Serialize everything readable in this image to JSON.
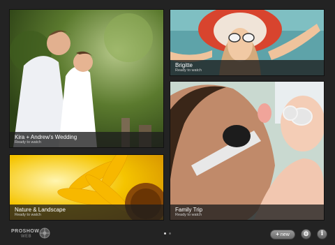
{
  "tiles": [
    {
      "title": "Kira + Andrew's Wedding",
      "status": "Ready to watch"
    },
    {
      "title": "Brigitte",
      "status": "Ready to watch"
    },
    {
      "title": "Nature & Landscape",
      "status": "Ready to watch"
    },
    {
      "title": "Family Trip",
      "status": "Ready to watch"
    }
  ],
  "logo": {
    "word1": "PROSHOW",
    "word2": "WEB"
  },
  "pager": {
    "pages": 2,
    "current": 1
  },
  "toolbar": {
    "new_label": "new",
    "new_icon": "plus-icon",
    "settings_icon": "gear-icon",
    "info_icon": "info-icon"
  },
  "colors": {
    "background": "#232323",
    "caption_bar": "#1e1e1e"
  }
}
